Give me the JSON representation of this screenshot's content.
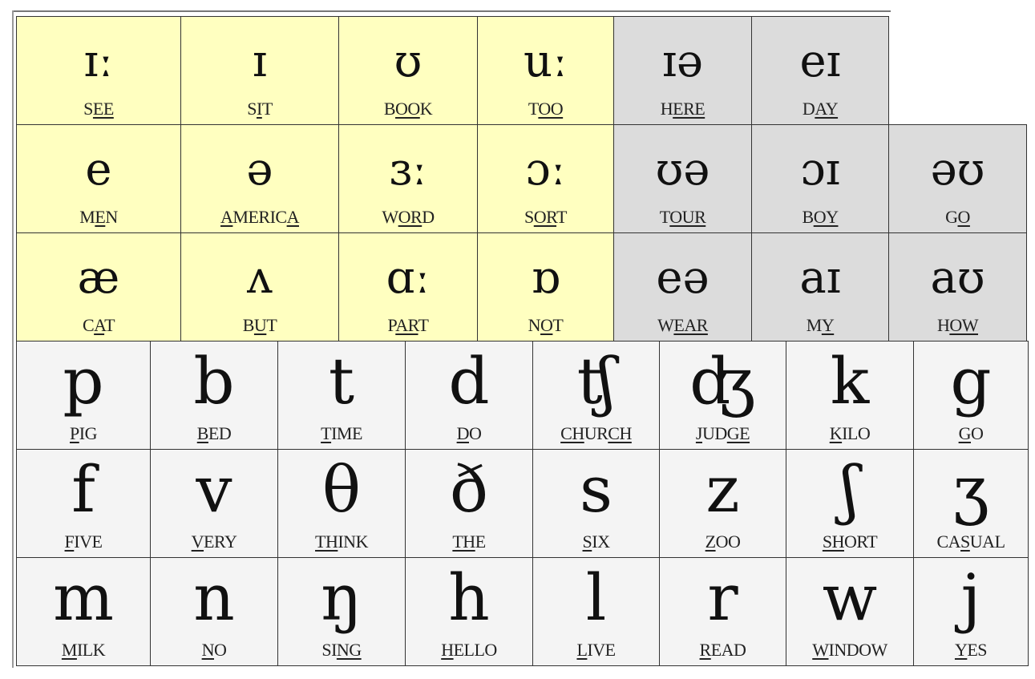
{
  "colors": {
    "monophthong_bg": "#ffffc0",
    "diphthong_bg": "#dcdcdc",
    "consonant_bg": "#f4f4f4"
  },
  "monophthongs": [
    [
      {
        "symbol": "ɪː",
        "word": [
          {
            "t": "S"
          },
          {
            "u": "EE"
          }
        ]
      },
      {
        "symbol": "ɪ",
        "word": [
          {
            "t": "S"
          },
          {
            "u": "I"
          },
          {
            "t": "T"
          }
        ]
      },
      {
        "symbol": "ʊ",
        "word": [
          {
            "t": "B"
          },
          {
            "u": "OO"
          },
          {
            "t": "K"
          }
        ]
      },
      {
        "symbol": "uː",
        "word": [
          {
            "t": "T"
          },
          {
            "u": "OO"
          }
        ]
      }
    ],
    [
      {
        "symbol": "e",
        "word": [
          {
            "t": "M"
          },
          {
            "u": "E"
          },
          {
            "t": "N"
          }
        ]
      },
      {
        "symbol": "ə",
        "word": [
          {
            "u": "A"
          },
          {
            "t": "MERIC"
          },
          {
            "u": "A"
          }
        ]
      },
      {
        "symbol": "ɜː",
        "word": [
          {
            "t": "W"
          },
          {
            "u": "OR"
          },
          {
            "t": "D"
          }
        ]
      },
      {
        "symbol": "ɔː",
        "word": [
          {
            "t": "S"
          },
          {
            "u": "OR"
          },
          {
            "t": "T"
          }
        ]
      }
    ],
    [
      {
        "symbol": "æ",
        "word": [
          {
            "t": "C"
          },
          {
            "u": "A"
          },
          {
            "t": "T"
          }
        ]
      },
      {
        "symbol": "ʌ",
        "word": [
          {
            "t": "B"
          },
          {
            "u": "U"
          },
          {
            "t": "T"
          }
        ]
      },
      {
        "symbol": "ɑː",
        "word": [
          {
            "t": "P"
          },
          {
            "u": "AR"
          },
          {
            "t": "T"
          }
        ]
      },
      {
        "symbol": "ɒ",
        "word": [
          {
            "t": "N"
          },
          {
            "u": "O"
          },
          {
            "t": "T"
          }
        ]
      }
    ]
  ],
  "diphthongs": [
    [
      {
        "symbol": "ɪə",
        "word": [
          {
            "t": "H"
          },
          {
            "u": "ERE"
          }
        ]
      },
      {
        "symbol": "eɪ",
        "word": [
          {
            "t": "D"
          },
          {
            "u": "AY"
          }
        ]
      }
    ],
    [
      {
        "symbol": "ʊə",
        "word": [
          {
            "t": "T"
          },
          {
            "u": "OUR"
          }
        ]
      },
      {
        "symbol": "ɔɪ",
        "word": [
          {
            "t": "B"
          },
          {
            "u": "OY"
          }
        ]
      },
      {
        "symbol": "əʊ",
        "word": [
          {
            "t": "G"
          },
          {
            "u": "O"
          }
        ]
      }
    ],
    [
      {
        "symbol": "eə",
        "word": [
          {
            "t": "W"
          },
          {
            "u": "EAR"
          }
        ]
      },
      {
        "symbol": "aɪ",
        "word": [
          {
            "t": "M"
          },
          {
            "u": "Y"
          }
        ]
      },
      {
        "symbol": "aʊ",
        "word": [
          {
            "t": "H"
          },
          {
            "u": "OW"
          }
        ]
      }
    ]
  ],
  "consonants": [
    [
      {
        "symbol": "p",
        "word": [
          {
            "u": "P"
          },
          {
            "t": "IG"
          }
        ]
      },
      {
        "symbol": "b",
        "word": [
          {
            "u": "B"
          },
          {
            "t": "ED"
          }
        ]
      },
      {
        "symbol": "t",
        "word": [
          {
            "u": "T"
          },
          {
            "t": "IME"
          }
        ]
      },
      {
        "symbol": "d",
        "word": [
          {
            "u": "D"
          },
          {
            "t": "O"
          }
        ]
      },
      {
        "symbol": "ʧ",
        "word": [
          {
            "u": "CH"
          },
          {
            "t": "UR"
          },
          {
            "u": "CH"
          }
        ]
      },
      {
        "symbol": "ʤ",
        "word": [
          {
            "u": "J"
          },
          {
            "t": "UD"
          },
          {
            "u": "GE"
          }
        ]
      },
      {
        "symbol": "k",
        "word": [
          {
            "u": "K"
          },
          {
            "t": "ILO"
          }
        ]
      },
      {
        "symbol": "g",
        "word": [
          {
            "u": "G"
          },
          {
            "t": "O"
          }
        ]
      }
    ],
    [
      {
        "symbol": "f",
        "word": [
          {
            "u": "F"
          },
          {
            "t": "IVE"
          }
        ]
      },
      {
        "symbol": "v",
        "word": [
          {
            "u": "V"
          },
          {
            "t": "ERY"
          }
        ]
      },
      {
        "symbol": "θ",
        "word": [
          {
            "u": "TH"
          },
          {
            "t": "INK"
          }
        ]
      },
      {
        "symbol": "ð",
        "word": [
          {
            "u": "TH"
          },
          {
            "t": "E"
          }
        ]
      },
      {
        "symbol": "s",
        "word": [
          {
            "u": "S"
          },
          {
            "t": "IX"
          }
        ]
      },
      {
        "symbol": "z",
        "word": [
          {
            "u": "Z"
          },
          {
            "t": "OO"
          }
        ]
      },
      {
        "symbol": "ʃ",
        "word": [
          {
            "u": "SH"
          },
          {
            "t": "ORT"
          }
        ]
      },
      {
        "symbol": "ʒ",
        "word": [
          {
            "t": "CA"
          },
          {
            "u": "S"
          },
          {
            "t": "UAL"
          }
        ]
      }
    ],
    [
      {
        "symbol": "m",
        "word": [
          {
            "u": "M"
          },
          {
            "t": "ILK"
          }
        ]
      },
      {
        "symbol": "n",
        "word": [
          {
            "u": "N"
          },
          {
            "t": "O"
          }
        ]
      },
      {
        "symbol": "ŋ",
        "word": [
          {
            "t": "SI"
          },
          {
            "u": "NG"
          }
        ]
      },
      {
        "symbol": "h",
        "word": [
          {
            "u": "H"
          },
          {
            "t": "ELLO"
          }
        ]
      },
      {
        "symbol": "l",
        "word": [
          {
            "u": "L"
          },
          {
            "t": "IVE"
          }
        ]
      },
      {
        "symbol": "r",
        "word": [
          {
            "u": "R"
          },
          {
            "t": "EAD"
          }
        ]
      },
      {
        "symbol": "w",
        "word": [
          {
            "u": "W"
          },
          {
            "t": "INDOW"
          }
        ]
      },
      {
        "symbol": "j",
        "word": [
          {
            "u": "Y"
          },
          {
            "t": "ES"
          }
        ]
      }
    ]
  ]
}
